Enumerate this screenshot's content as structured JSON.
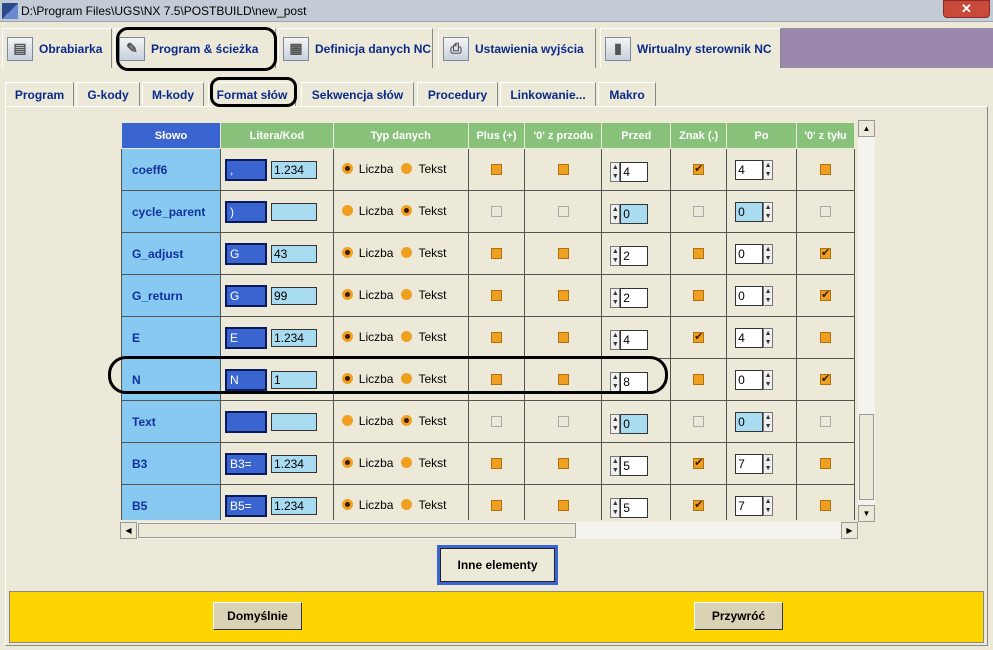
{
  "window": {
    "title": "D:\\Program Files\\UGS\\NX 7.5\\POSTBUILD\\new_post",
    "close": "✕"
  },
  "main_tabs": [
    {
      "label": "Obrabiarka",
      "icon": "machine-icon"
    },
    {
      "label": "Program & ścieżka",
      "icon": "toolpath-icon"
    },
    {
      "label": "Definicja danych NC",
      "icon": "nc-data-icon"
    },
    {
      "label": "Ustawienia wyjścia",
      "icon": "printer-icon"
    },
    {
      "label": "Wirtualny sterownik NC",
      "icon": "controller-icon"
    }
  ],
  "sub_tabs": [
    "Program",
    "G-kody",
    "M-kody",
    "Format słów",
    "Sekwencja słów",
    "Procedury",
    "Linkowanie...",
    "Makro"
  ],
  "columns": [
    "Słowo",
    "Litera/Kod",
    "Typ danych",
    "Plus (+)",
    "'0' z przodu",
    "Przed",
    "Znak (.)",
    "Po",
    "'0' z tyłu"
  ],
  "radio_labels": {
    "number": "Liczba",
    "text": "Tekst"
  },
  "rows": [
    {
      "name": "coeff6",
      "letter": ",",
      "code": "1.234",
      "type": "Liczba",
      "plus": true,
      "lead": true,
      "before": "4",
      "sign": "on",
      "after": "4",
      "trail": true
    },
    {
      "name": "cycle_parent",
      "letter": ")",
      "code": "",
      "type": "Tekst",
      "plus": false,
      "lead": false,
      "before": "0",
      "sign": "dis",
      "after": "0",
      "trail": false
    },
    {
      "name": "G_adjust",
      "letter": "G",
      "code": "43",
      "type": "Liczba",
      "plus": true,
      "lead": true,
      "before": "2",
      "sign": "off",
      "after": "0",
      "trail": "on"
    },
    {
      "name": "G_return",
      "letter": "G",
      "code": "99",
      "type": "Liczba",
      "plus": true,
      "lead": true,
      "before": "2",
      "sign": "off",
      "after": "0",
      "trail": "on"
    },
    {
      "name": "E",
      "letter": "E",
      "code": "1.234",
      "type": "Liczba",
      "plus": true,
      "lead": true,
      "before": "4",
      "sign": "on",
      "after": "4",
      "trail": true
    },
    {
      "name": "N",
      "letter": "N",
      "code": "1",
      "type": "Liczba",
      "plus": true,
      "lead": true,
      "before": "8",
      "sign": "off",
      "after": "0",
      "trail": "on"
    },
    {
      "name": "Text",
      "letter": "",
      "code": "",
      "type": "Tekst",
      "plus": false,
      "lead": false,
      "before": "0",
      "sign": "dis",
      "after": "0",
      "trail": false
    },
    {
      "name": "B3",
      "letter": "B3=",
      "code": "1.234",
      "type": "Liczba",
      "plus": true,
      "lead": true,
      "before": "5",
      "sign": "on",
      "after": "7",
      "trail": true
    },
    {
      "name": "B5",
      "letter": "B5=",
      "code": "1.234",
      "type": "Liczba",
      "plus": true,
      "lead": true,
      "before": "5",
      "sign": "on",
      "after": "7",
      "trail": true
    }
  ],
  "buttons": {
    "other_elements": "Inne elementy",
    "default": "Domyślnie",
    "restore": "Przywróć"
  },
  "colors": {
    "header_green": "#87c17a",
    "name_cell": "#87c9f0",
    "letter_blue": "#3a64d0",
    "bottom_bar": "#ffd500",
    "tab_fill": "#9a88ac"
  }
}
